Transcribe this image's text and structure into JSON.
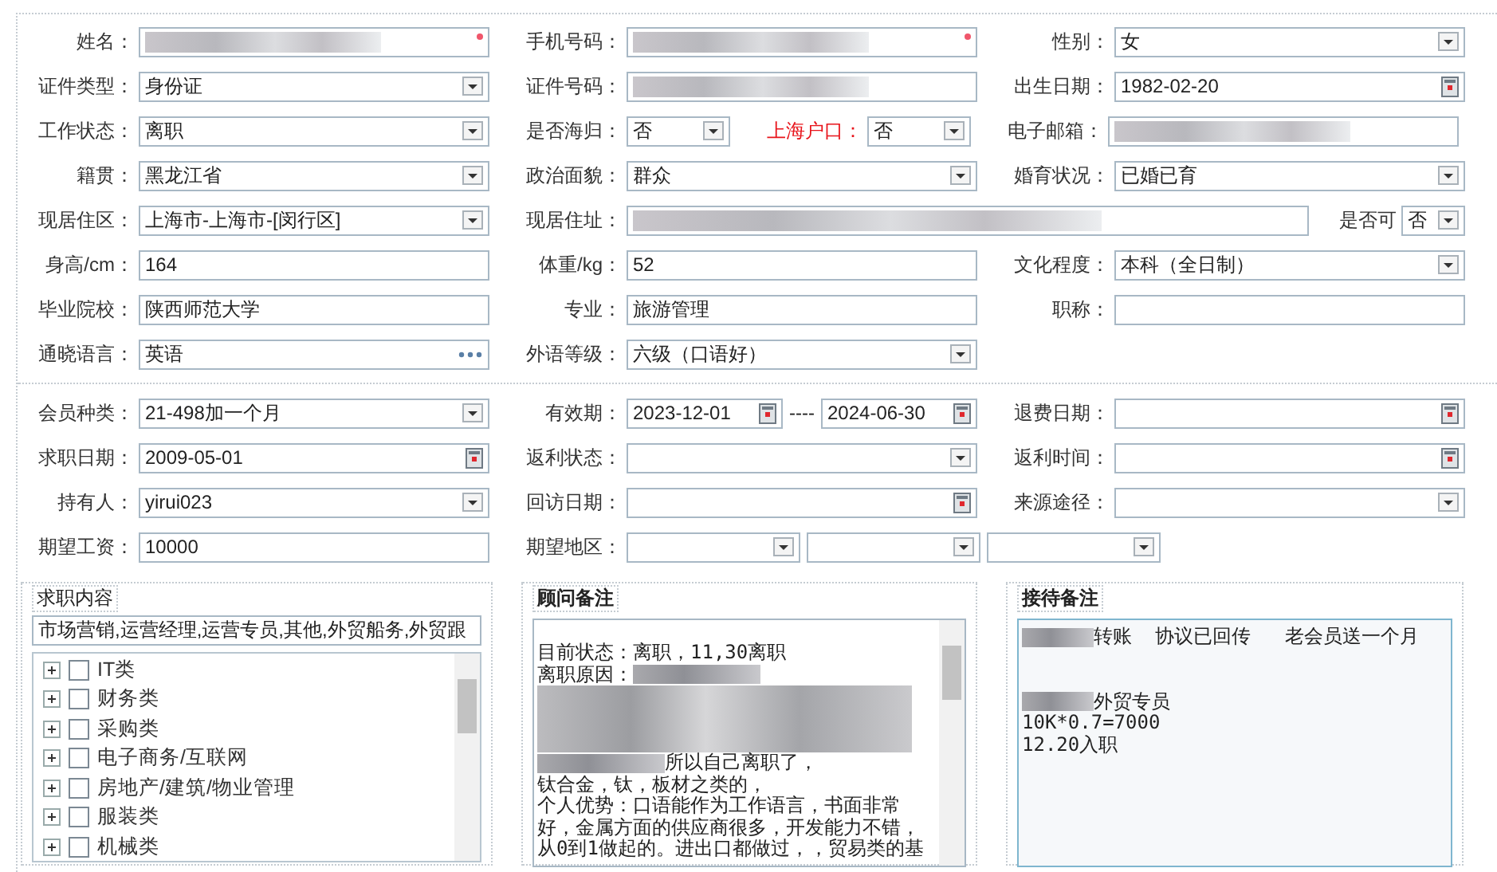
{
  "sections": [
    {
      "rows": [
        {
          "cells": [
            {
              "label": "姓名：",
              "kind": "normal",
              "controls": [
                {
                  "kind": "text",
                  "redacted": true,
                  "required": true
                }
              ]
            },
            {
              "label": "手机号码：",
              "kind": "normal",
              "controls": [
                {
                  "kind": "text",
                  "redacted": true,
                  "required": true
                }
              ]
            },
            {
              "label": "性别：",
              "kind": "normal",
              "controls": [
                {
                  "kind": "select",
                  "value": "女"
                }
              ]
            }
          ]
        },
        {
          "cells": [
            {
              "label": "证件类型：",
              "kind": "normal",
              "controls": [
                {
                  "kind": "select",
                  "value": "身份证"
                }
              ]
            },
            {
              "label": "证件号码：",
              "kind": "normal",
              "controls": [
                {
                  "kind": "text",
                  "redacted": true
                }
              ]
            },
            {
              "label": "出生日期：",
              "kind": "normal",
              "controls": [
                {
                  "kind": "date",
                  "value": "1982-02-20"
                }
              ]
            }
          ]
        },
        {
          "cells": [
            {
              "label": "工作状态：",
              "kind": "normal",
              "controls": [
                {
                  "kind": "select",
                  "value": "离职"
                }
              ]
            },
            {
              "label": "是否海归：",
              "kind": "small",
              "controls": [
                {
                  "kind": "select",
                  "value": "否"
                }
              ]
            },
            {
              "label": "上海户口：",
              "kind": "small",
              "highlighted": true,
              "controls": [
                {
                  "kind": "select",
                  "value": "否"
                }
              ]
            },
            {
              "label": "电子邮箱：",
              "kind": "normal",
              "controls": [
                {
                  "kind": "text",
                  "redacted": true
                }
              ]
            }
          ]
        },
        {
          "cells": [
            {
              "label": "籍贯：",
              "kind": "normal",
              "controls": [
                {
                  "kind": "select",
                  "value": "黑龙江省"
                }
              ]
            },
            {
              "label": "政治面貌：",
              "kind": "normal",
              "controls": [
                {
                  "kind": "select",
                  "value": "群众"
                }
              ]
            },
            {
              "label": "婚育状况：",
              "kind": "normal",
              "controls": [
                {
                  "kind": "select",
                  "value": "已婚已育"
                }
              ]
            }
          ]
        },
        {
          "cells": [
            {
              "label": "现居住区：",
              "kind": "normal",
              "controls": [
                {
                  "kind": "select",
                  "value": "上海市-上海市-[闵行区]"
                }
              ]
            },
            {
              "label": "现居住址：",
              "kind": "wide",
              "controls": [
                {
                  "kind": "text",
                  "redacted": true
                }
              ]
            },
            {
              "label": "是否可",
              "kind": "tiny",
              "controls": [
                {
                  "kind": "select",
                  "value": "否"
                }
              ]
            }
          ]
        },
        {
          "cells": [
            {
              "label": "身高/cm：",
              "kind": "normal",
              "controls": [
                {
                  "kind": "text",
                  "value": "164"
                }
              ]
            },
            {
              "label": "体重/kg：",
              "kind": "normal",
              "controls": [
                {
                  "kind": "text",
                  "value": "52"
                }
              ]
            },
            {
              "label": "文化程度：",
              "kind": "normal",
              "controls": [
                {
                  "kind": "select",
                  "value": "本科（全日制）"
                }
              ]
            }
          ]
        },
        {
          "cells": [
            {
              "label": "毕业院校：",
              "kind": "normal",
              "controls": [
                {
                  "kind": "text",
                  "value": "陕西师范大学"
                }
              ]
            },
            {
              "label": "专业：",
              "kind": "normal",
              "controls": [
                {
                  "kind": "text",
                  "value": "旅游管理"
                }
              ]
            },
            {
              "label": "职称：",
              "kind": "normal",
              "controls": [
                {
                  "kind": "text"
                }
              ]
            }
          ]
        },
        {
          "cells": [
            {
              "label": "通晓语言：",
              "kind": "normal",
              "controls": [
                {
                  "kind": "lookup",
                  "value": "英语"
                }
              ]
            },
            {
              "label": "外语等级：",
              "kind": "normal",
              "controls": [
                {
                  "kind": "select",
                  "value": "六级（口语好）"
                }
              ]
            }
          ]
        }
      ]
    },
    {
      "rows": [
        {
          "cells": [
            {
              "label": "会员种类：",
              "kind": "normal",
              "controls": [
                {
                  "kind": "select",
                  "value": "21-498加一个月"
                }
              ]
            },
            {
              "label": "有效期：",
              "kind": "normal",
              "controls": [
                {
                  "kind": "date",
                  "value": "2023-12-01"
                },
                {
                  "kind": "separator",
                  "value": "----"
                },
                {
                  "kind": "date",
                  "value": "2024-06-30"
                }
              ]
            },
            {
              "label": "退费日期：",
              "kind": "normal",
              "controls": [
                {
                  "kind": "date"
                }
              ]
            }
          ]
        },
        {
          "cells": [
            {
              "label": "求职日期：",
              "kind": "normal",
              "controls": [
                {
                  "kind": "date",
                  "value": "2009-05-01"
                }
              ]
            },
            {
              "label": "返利状态：",
              "kind": "normal",
              "controls": [
                {
                  "kind": "select"
                }
              ]
            },
            {
              "label": "返利时间：",
              "kind": "normal",
              "controls": [
                {
                  "kind": "date"
                }
              ]
            }
          ]
        },
        {
          "cells": [
            {
              "label": "持有人：",
              "kind": "normal",
              "controls": [
                {
                  "kind": "select",
                  "value": "yirui023"
                }
              ]
            },
            {
              "label": "回访日期：",
              "kind": "normal",
              "controls": [
                {
                  "kind": "date"
                }
              ]
            },
            {
              "label": "来源途径：",
              "kind": "normal",
              "controls": [
                {
                  "kind": "select"
                }
              ]
            }
          ]
        },
        {
          "cells": [
            {
              "label": "期望工资：",
              "kind": "normal",
              "controls": [
                {
                  "kind": "text",
                  "value": "10000"
                }
              ]
            },
            {
              "label": "期望地区：",
              "kind": "triple",
              "controls": [
                {
                  "kind": "select"
                },
                {
                  "kind": "select"
                },
                {
                  "kind": "select"
                }
              ]
            }
          ]
        }
      ]
    }
  ],
  "panels": [
    {
      "kind": "picker",
      "legend": "求职内容",
      "selected_text": "市场营销,运营经理,运营专员,其他,外贸船务,外贸跟",
      "categories": [
        {
          "label": "IT类",
          "expanded": false,
          "checked": false
        },
        {
          "label": "财务类",
          "expanded": false,
          "checked": false
        },
        {
          "label": "采购类",
          "expanded": false,
          "checked": false
        },
        {
          "label": "电子商务/互联网",
          "expanded": false,
          "checked": false
        },
        {
          "label": "房地产/建筑/物业管理",
          "expanded": false,
          "checked": false
        },
        {
          "label": "服装类",
          "expanded": false,
          "checked": false
        },
        {
          "label": "机械类",
          "expanded": false,
          "checked": false
        }
      ]
    },
    {
      "kind": "notes",
      "legend": "顾问备注",
      "scrollbar": true,
      "lines": [
        {
          "kind": "text",
          "text": "目前状态：离职，11,30离职"
        },
        {
          "kind": "text",
          "text": "离职原因：",
          "redacted_after": true
        },
        {
          "kind": "blurred"
        },
        {
          "kind": "text",
          "text": "所以自己离职了，",
          "redacted_before": true
        },
        {
          "kind": "text",
          "text": "钛合金，钛，板材之类的，"
        },
        {
          "kind": "text",
          "text": "个人优势：口语能作为工作语言，书面非常"
        },
        {
          "kind": "text",
          "text": "好，金属方面的供应商很多，开发能力不错，"
        },
        {
          "kind": "text",
          "text": "从0到1做起的。进出口都做过，，贸易类的基"
        }
      ]
    },
    {
      "kind": "notes",
      "legend": "接待备注",
      "scrollbar": false,
      "lines": [
        {
          "kind": "text",
          "text": "转账  协议已回传   老会员送一个月",
          "redacted_before": true
        },
        {
          "kind": "blank"
        },
        {
          "kind": "blank"
        },
        {
          "kind": "text",
          "text": "外贸专员",
          "redacted_before": true
        },
        {
          "kind": "text",
          "text": "10K*0.7=7000"
        },
        {
          "kind": "text",
          "text": "12.20入职"
        }
      ]
    }
  ]
}
